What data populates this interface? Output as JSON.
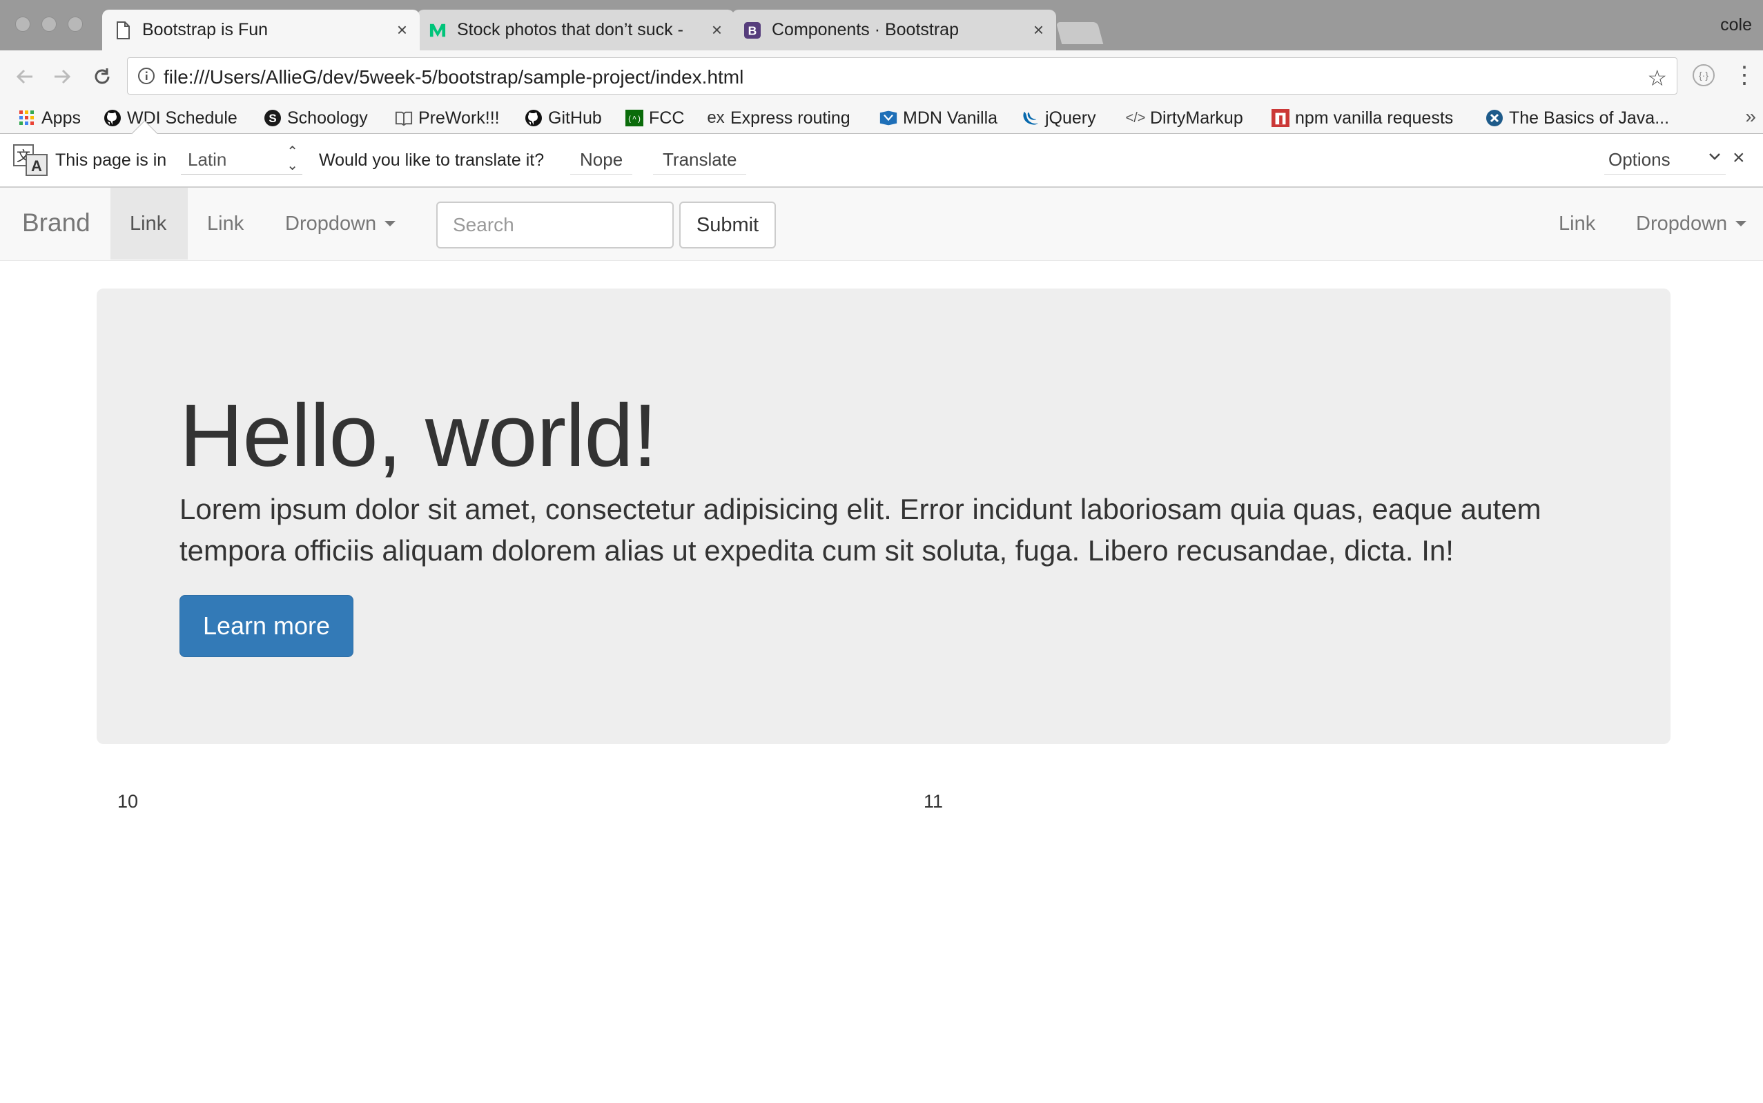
{
  "browser": {
    "tabs": [
      {
        "title": "Bootstrap is Fun",
        "icon": "page-icon",
        "active": true
      },
      {
        "title": "Stock photos that don’t suck -",
        "icon": "medium-icon",
        "active": false
      },
      {
        "title": "Components · Bootstrap",
        "icon": "bootstrap-icon",
        "active": false
      }
    ],
    "profile_name": "cole",
    "url": "file:///Users/AllieG/dev/5week-5/bootstrap/sample-project/index.html",
    "bookmarks": [
      {
        "label": "Apps",
        "icon": "apps-grid-icon"
      },
      {
        "label": "WDI Schedule",
        "icon": "github-icon"
      },
      {
        "label": "Schoology",
        "icon": "schoology-icon"
      },
      {
        "label": "PreWork!!!",
        "icon": "book-icon"
      },
      {
        "label": "GitHub",
        "icon": "github-icon"
      },
      {
        "label": "FCC",
        "icon": "fcc-icon"
      },
      {
        "label": "Express routing",
        "icon": "express-icon"
      },
      {
        "label": "MDN Vanilla",
        "icon": "mdn-icon"
      },
      {
        "label": "jQuery",
        "icon": "jquery-icon"
      },
      {
        "label": "DirtyMarkup",
        "icon": "code-icon"
      },
      {
        "label": "npm vanilla requests",
        "icon": "npm-icon"
      },
      {
        "label": "The Basics of Java...",
        "icon": "x-circle-icon"
      }
    ],
    "more_bookmarks": "»"
  },
  "translate_bar": {
    "page_is_in": "This page is in",
    "language": "Latin",
    "question": "Would you like to translate it?",
    "nope": "Nope",
    "translate": "Translate",
    "options": "Options",
    "close": "×"
  },
  "navbar": {
    "brand": "Brand",
    "links_left": [
      "Link",
      "Link"
    ],
    "dropdown_left": "Dropdown",
    "search_placeholder": "Search",
    "submit": "Submit",
    "link_right": "Link",
    "dropdown_right": "Dropdown"
  },
  "jumbotron": {
    "heading": "Hello, world!",
    "text": "Lorem ipsum dolor sit amet, consectetur adipisicing elit. Error incidunt laboriosam quia quas, eaque autem tempora officiis aliquam dolorem alias ut expedita cum sit soluta, fuga. Libero recusandae, dicta. In!",
    "button": "Learn more"
  },
  "grid": {
    "col1": "10",
    "col2": "11"
  },
  "colors": {
    "primary_button": "#337ab7",
    "jumbotron_bg": "#eeeeee",
    "navbar_bg": "#f8f8f8"
  }
}
